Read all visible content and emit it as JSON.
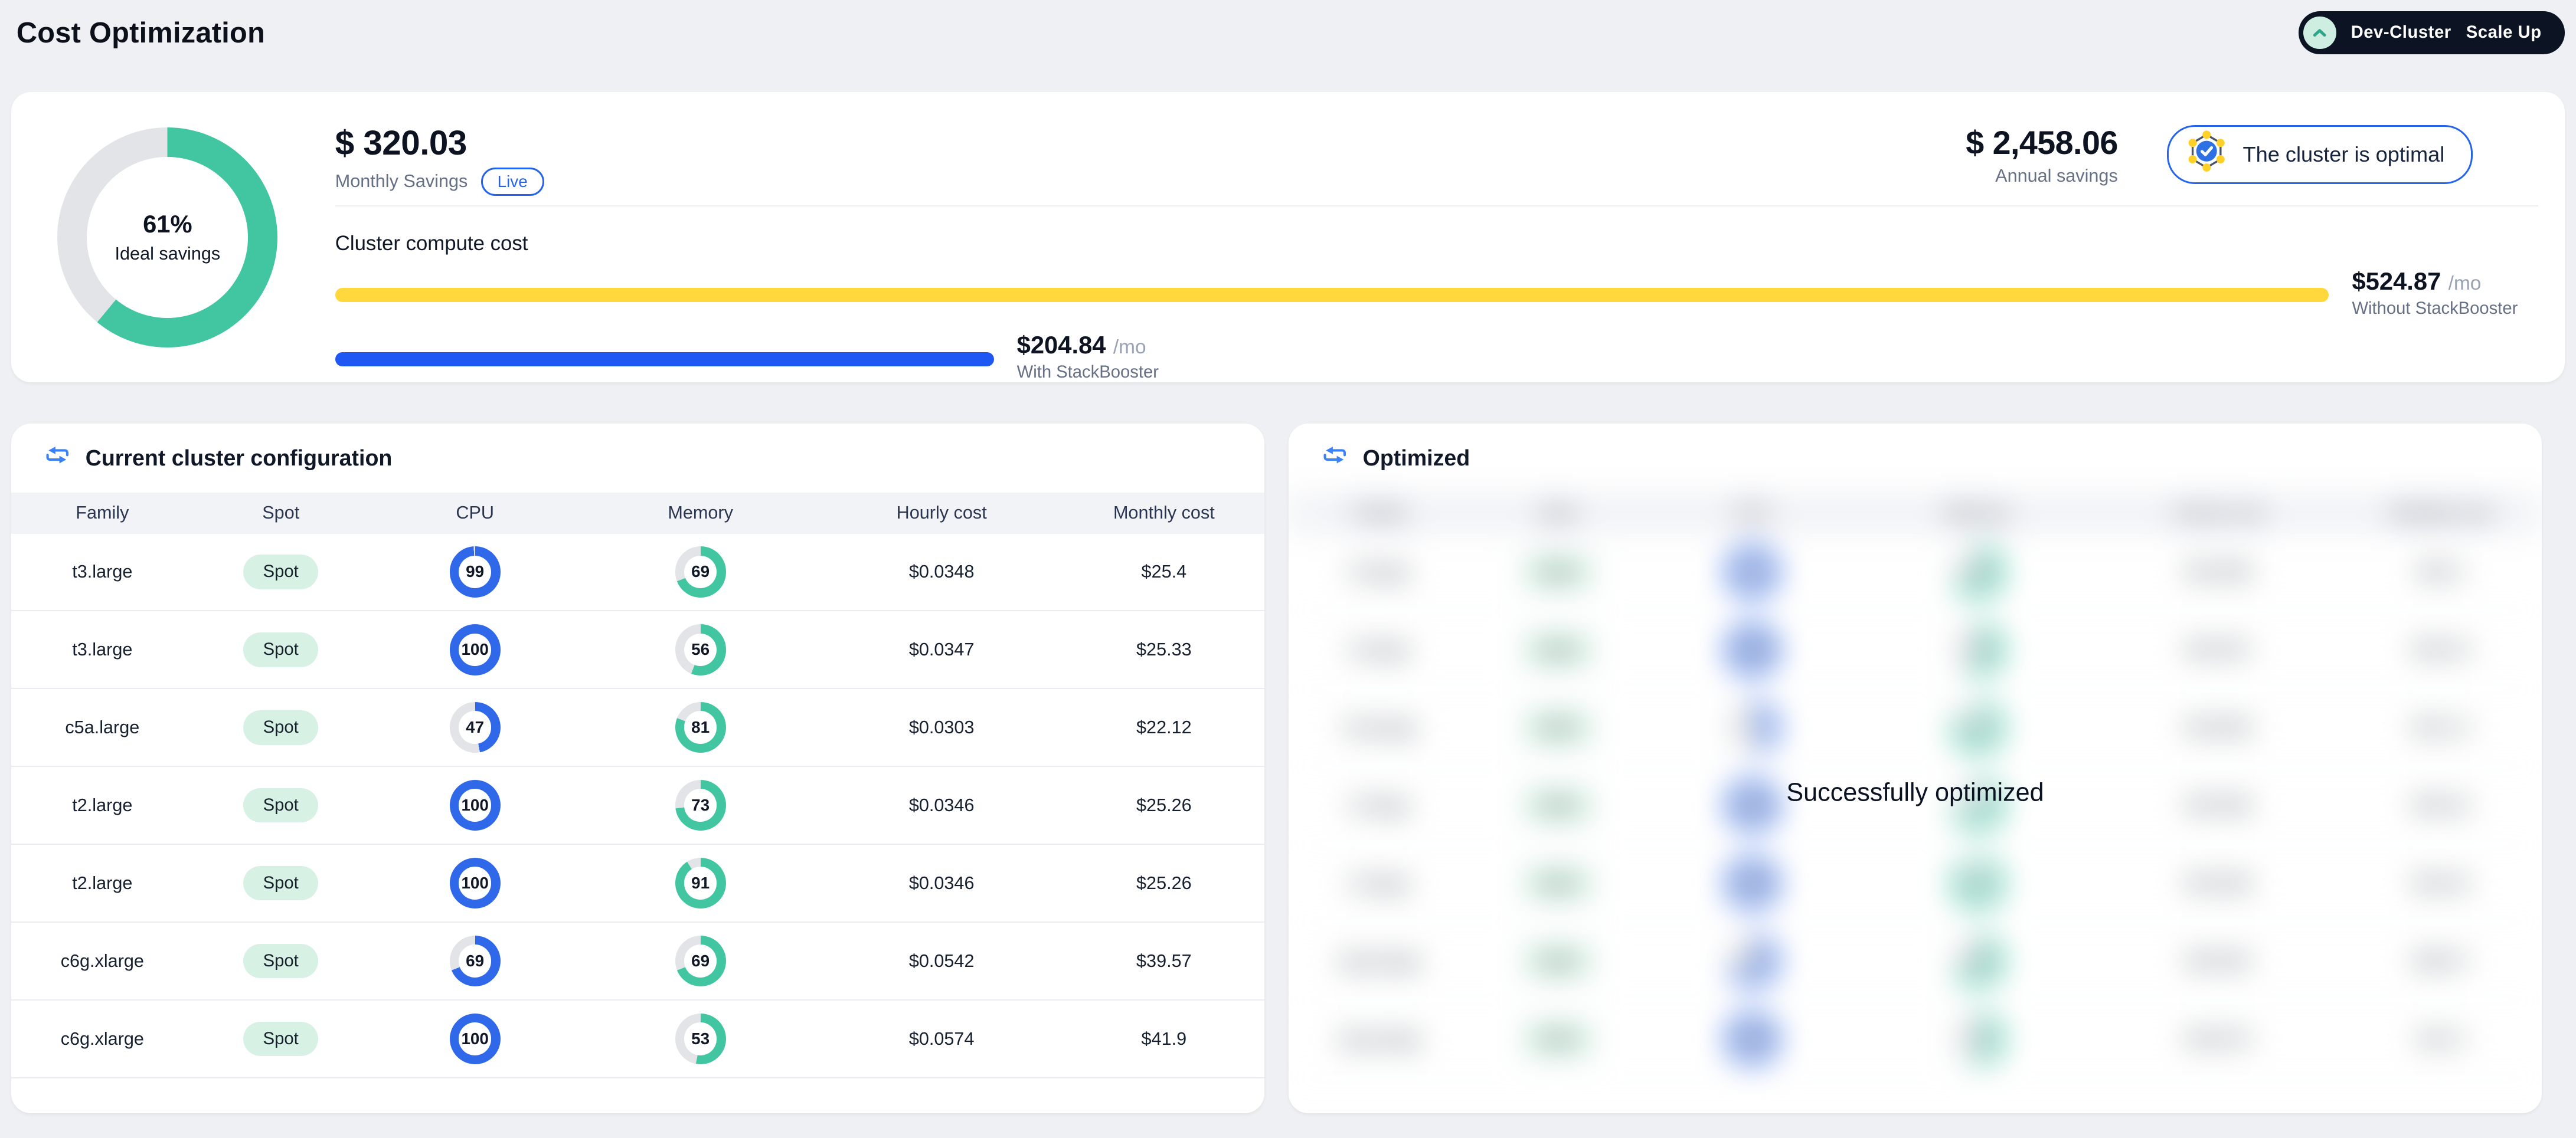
{
  "header": {
    "title": "Cost Optimization",
    "cluster_pill": {
      "cluster": "Dev-Cluster",
      "action": "Scale Up"
    }
  },
  "summary": {
    "donut": {
      "percent": 61,
      "value_text": "61%",
      "label": "Ideal savings"
    },
    "monthly": {
      "amount": "$ 320.03",
      "label": "Monthly Savings",
      "badge": "Live"
    },
    "annual": {
      "amount": "$ 2,458.06",
      "label": "Annual savings"
    },
    "optimal_badge": "The cluster is optimal",
    "compute": {
      "title": "Cluster compute cost",
      "without": {
        "amount": "$524.87",
        "unit": "/mo",
        "label": "Without StackBooster",
        "bar_pct": 90.5
      },
      "with": {
        "amount": "$204.84",
        "unit": "/mo",
        "label": "With StackBooster",
        "bar_pct": 29.9
      }
    }
  },
  "current": {
    "title": "Current cluster configuration",
    "columns": [
      "Family",
      "Spot",
      "CPU",
      "Memory",
      "Hourly cost",
      "Monthly cost"
    ],
    "rows": [
      {
        "family": "t3.large",
        "spot": "Spot",
        "cpu": 99,
        "memory": 69,
        "hourly": "$0.0348",
        "monthly": "$25.4"
      },
      {
        "family": "t3.large",
        "spot": "Spot",
        "cpu": 100,
        "memory": 56,
        "hourly": "$0.0347",
        "monthly": "$25.33"
      },
      {
        "family": "c5a.large",
        "spot": "Spot",
        "cpu": 47,
        "memory": 81,
        "hourly": "$0.0303",
        "monthly": "$22.12"
      },
      {
        "family": "t2.large",
        "spot": "Spot",
        "cpu": 100,
        "memory": 73,
        "hourly": "$0.0346",
        "monthly": "$25.26"
      },
      {
        "family": "t2.large",
        "spot": "Spot",
        "cpu": 100,
        "memory": 91,
        "hourly": "$0.0346",
        "monthly": "$25.26"
      },
      {
        "family": "c6g.xlarge",
        "spot": "Spot",
        "cpu": 69,
        "memory": 69,
        "hourly": "$0.0542",
        "monthly": "$39.57"
      },
      {
        "family": "c6g.xlarge",
        "spot": "Spot",
        "cpu": 100,
        "memory": 53,
        "hourly": "$0.0574",
        "monthly": "$41.9"
      }
    ]
  },
  "optimized": {
    "title": "Optimized",
    "overlay": "Successfully optimized",
    "blurred": true
  },
  "colors": {
    "accent_blue": "#2563eb",
    "bar_blue": "#1f57f2",
    "donut_blue": "#2f68e8",
    "bar_yellow": "#ffd83d",
    "teal": "#42c6a1",
    "mint": "#d8f1e5",
    "navy_pill": "#0c1424",
    "donut_track": "#e3e4e7"
  }
}
